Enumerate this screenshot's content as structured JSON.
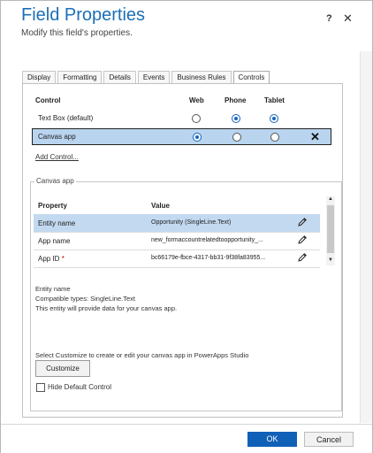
{
  "dialog": {
    "title": "Field Properties",
    "subtitle": "Modify this field's properties.",
    "help_label": "?",
    "close_label": "✕"
  },
  "tabs": [
    {
      "label": "Display"
    },
    {
      "label": "Formatting"
    },
    {
      "label": "Details"
    },
    {
      "label": "Events"
    },
    {
      "label": "Business Rules"
    },
    {
      "label": "Controls",
      "active": true
    }
  ],
  "controls": {
    "headers": {
      "control": "Control",
      "web": "Web",
      "phone": "Phone",
      "tablet": "Tablet"
    },
    "rows": [
      {
        "name": "Text Box (default)",
        "web": false,
        "phone": true,
        "tablet": true,
        "selected": false
      },
      {
        "name": "Canvas app",
        "web": true,
        "phone": false,
        "tablet": false,
        "selected": true,
        "remove_label": "✕"
      }
    ],
    "add_control_label": "Add Control..."
  },
  "canvas_app": {
    "legend": "Canvas app",
    "property_header": "Property",
    "value_header": "Value",
    "properties": [
      {
        "name": "Entity name",
        "value": "Opportunity (SingleLine.Text)",
        "required": false,
        "selected": true
      },
      {
        "name": "App name",
        "value": "new_formaccountrelatedtoopportunity_...",
        "required": false,
        "selected": false
      },
      {
        "name": "App ID",
        "value": "bc66179e-fbce-4317-bb31-9f38fa83955...",
        "required": true,
        "required_mark": "*",
        "selected": false
      }
    ],
    "info_lines": [
      "Entity name",
      "Compatible types: SingleLine.Text",
      "This entity will provide data for your canvas app."
    ],
    "customize_text": "Select Customize to create or edit your canvas app in PowerApps Studio",
    "customize_label": "Customize",
    "hide_default_label": "Hide Default Control",
    "hide_default_checked": false
  },
  "footer": {
    "ok_label": "OK",
    "cancel_label": "Cancel"
  },
  "colors": {
    "title": "#1c6fb7",
    "ok_button": "#1160b7",
    "selected_row": "#b9d4ee",
    "required": "#c00000"
  }
}
